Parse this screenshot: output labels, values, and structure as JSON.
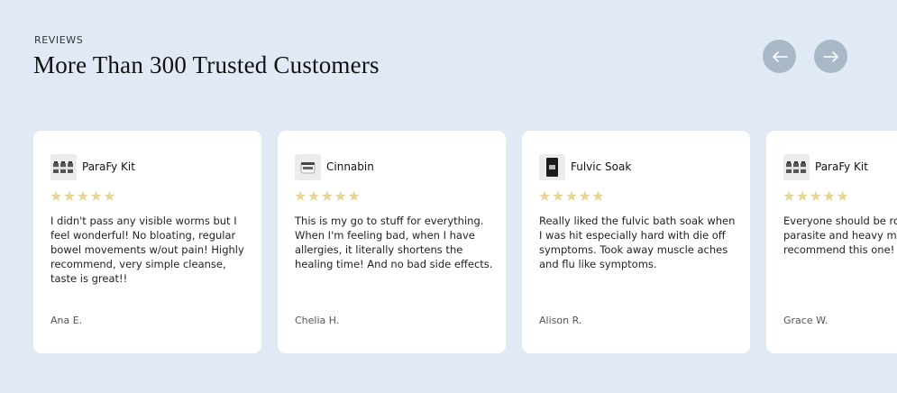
{
  "section": {
    "eyebrow": "REVIEWS",
    "title": "More Than 300 Trusted Customers"
  },
  "nav": {
    "prev_icon": "arrow-left-icon",
    "next_icon": "arrow-right-icon",
    "button_color": "#a9b8c6"
  },
  "colors": {
    "background": "#e1e9f5",
    "card": "#ffffff",
    "star": "#e6d596"
  },
  "reviews": [
    {
      "product": "ParaFy Kit",
      "thumb_icon": "bottles-kit-icon",
      "stars": "★★★★★",
      "rating": 5,
      "text": "I didn't pass any visible worms but I feel wonderful! No bloating, regular bowel movements w/out pain! Highly recommend, very simple cleanse, taste is great!!",
      "author": "Ana E."
    },
    {
      "product": "Cinnabin",
      "thumb_icon": "jar-icon",
      "stars": "★★★★★",
      "rating": 5,
      "text": "This is my go to stuff for everything. When I'm feeling bad, when I have allergies, it literally shortens the healing time! And no bad side effects.",
      "author": "Chelia H."
    },
    {
      "product": "Fulvic Soak",
      "thumb_icon": "pouch-icon",
      "stars": "★★★★★",
      "rating": 5,
      "text": "Really liked the fulvic bath soak when I was hit especially hard with die off symptoms. Took away muscle aches and flu like symptoms.",
      "author": "Alison R."
    },
    {
      "product": "ParaFy Kit",
      "thumb_icon": "bottles-kit-icon",
      "stars": "★★★★★",
      "rating": 5,
      "text_lines": [
        "Everyone should be rout",
        "parasite and heavy meta",
        "recommend this one!"
      ],
      "author": "Grace W."
    }
  ]
}
